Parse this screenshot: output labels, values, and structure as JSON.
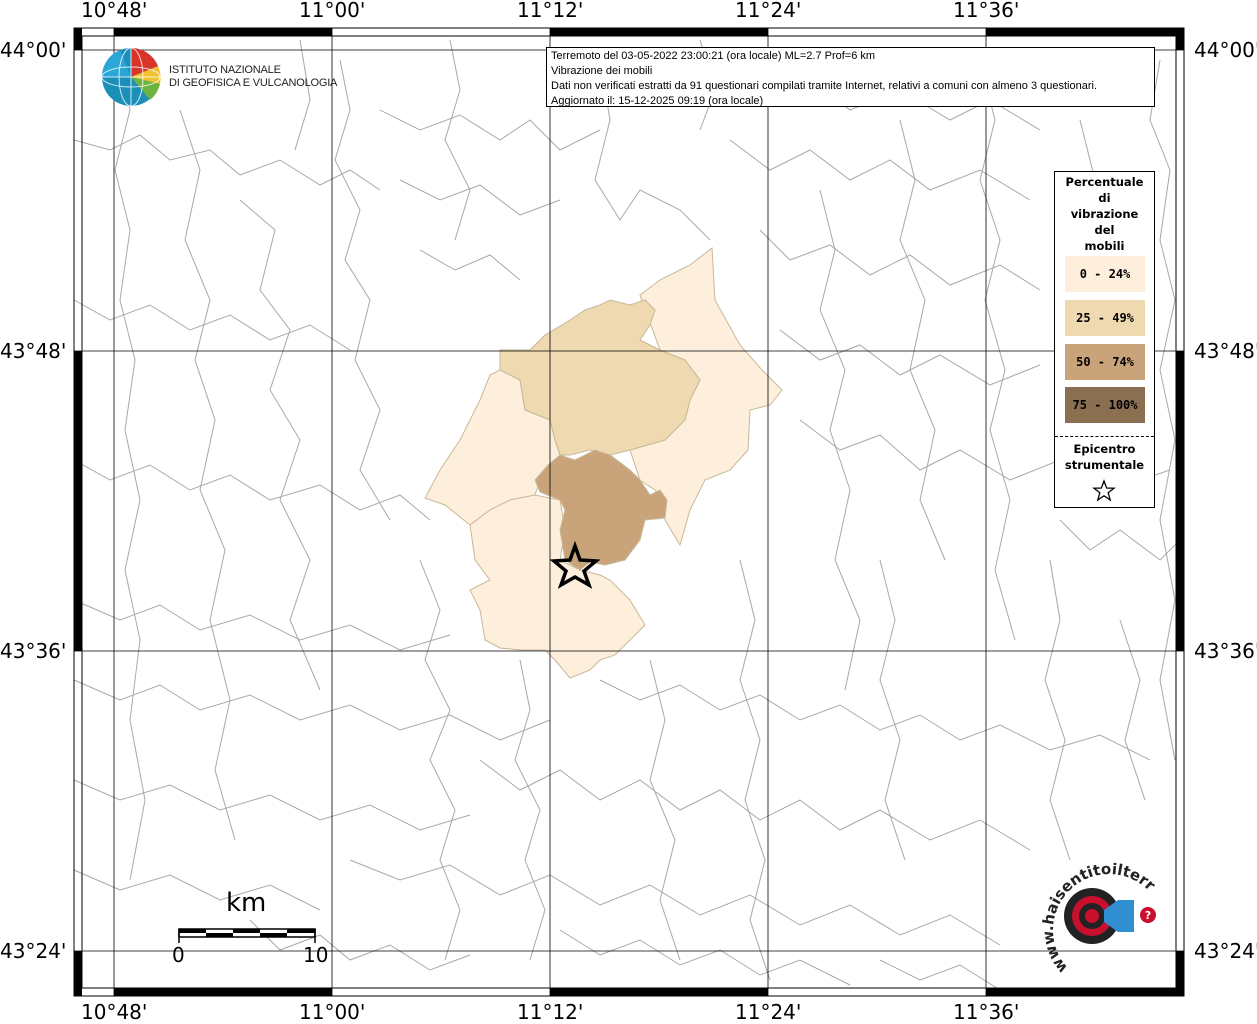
{
  "info": {
    "line1": "Terremoto del 03-05-2022 23:00:21 (ora locale) ML=2.7 Prof=6 km",
    "line2": "Vibrazione dei mobili",
    "line3": "Dati non verificati estratti da 91 questionari compilati tramite Internet, relativi a comuni con almeno 3 questionari.",
    "line4": "Aggiornato il: 15-12-2025 09:19 (ora locale)"
  },
  "logo_ingv": {
    "line1": "ISTITUTO NAZIONALE",
    "line2": "DI GEOFISICA E VULCANOLOGIA"
  },
  "axes": {
    "lon_labels": [
      "10°48'",
      "11°00'",
      "11°12'",
      "11°24'",
      "11°36'"
    ],
    "lat_labels": [
      "44°00'",
      "43°48'",
      "43°36'",
      "43°24'"
    ]
  },
  "legend": {
    "title": "Percentuale\ndi\nvibrazione\ndel\nmobili",
    "classes": [
      {
        "label": "0 - 24%",
        "color": "#fdefdc"
      },
      {
        "label": "25 - 49%",
        "color": "#eed9b1"
      },
      {
        "label": "50 - 74%",
        "color": "#c9a47a"
      },
      {
        "label": "75 - 100%",
        "color": "#8a7050"
      }
    ],
    "epicenter_label": "Epicentro\nstrumentale"
  },
  "scale_bar": {
    "unit": "km",
    "start": "0",
    "end": "10"
  },
  "logo_hsit": {
    "text": "www.haisentitoilterremoto.it"
  },
  "epicenter": {
    "lon": 11.21,
    "lat": 43.68
  },
  "colors": {
    "border": "#999999",
    "grid": "#000000"
  }
}
